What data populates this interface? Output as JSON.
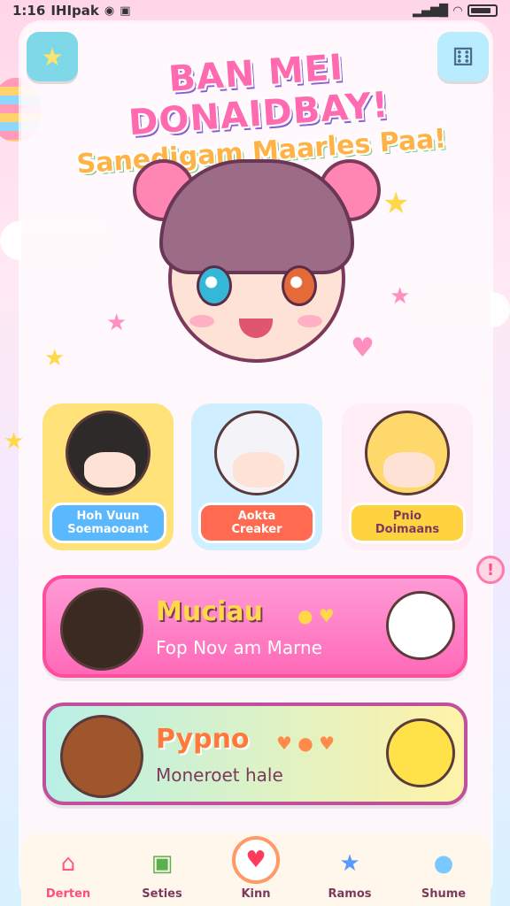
{
  "status_bar": {
    "time": "1:16",
    "carrier": "IHIpak"
  },
  "header": {
    "title": "BAN MEI DONAIDBAY!",
    "subtitle": "Sanedigam Maarles Paa!"
  },
  "characters": [
    {
      "line1": "Hoh Vuun",
      "line2": "Soemaooant",
      "color": "#5ab8ff"
    },
    {
      "line1": "Aokta",
      "line2": "Creaker",
      "color": "#ff6a50"
    },
    {
      "line1": "Pnio",
      "line2": "Doimaans",
      "color": "#ffd23f"
    }
  ],
  "modes": [
    {
      "title": "Muciau",
      "subtitle": "Fop Nov am Marne",
      "hearts": "● ♥",
      "color": "#ff7ec4"
    },
    {
      "title": "Pypno",
      "subtitle": "Moneroet hale",
      "hearts": "♥ ● ♥",
      "color": "#9be6e0"
    }
  ],
  "tabs": [
    {
      "label": "Derten",
      "icon": "⌂"
    },
    {
      "label": "Seties",
      "icon": "▣"
    },
    {
      "label": "Kinn",
      "icon": "♥"
    },
    {
      "label": "Ramos",
      "icon": "★"
    },
    {
      "label": "Shume",
      "icon": "●"
    }
  ],
  "icons": {
    "corner_left": "★",
    "corner_right": "⚅",
    "info_button": "!"
  }
}
